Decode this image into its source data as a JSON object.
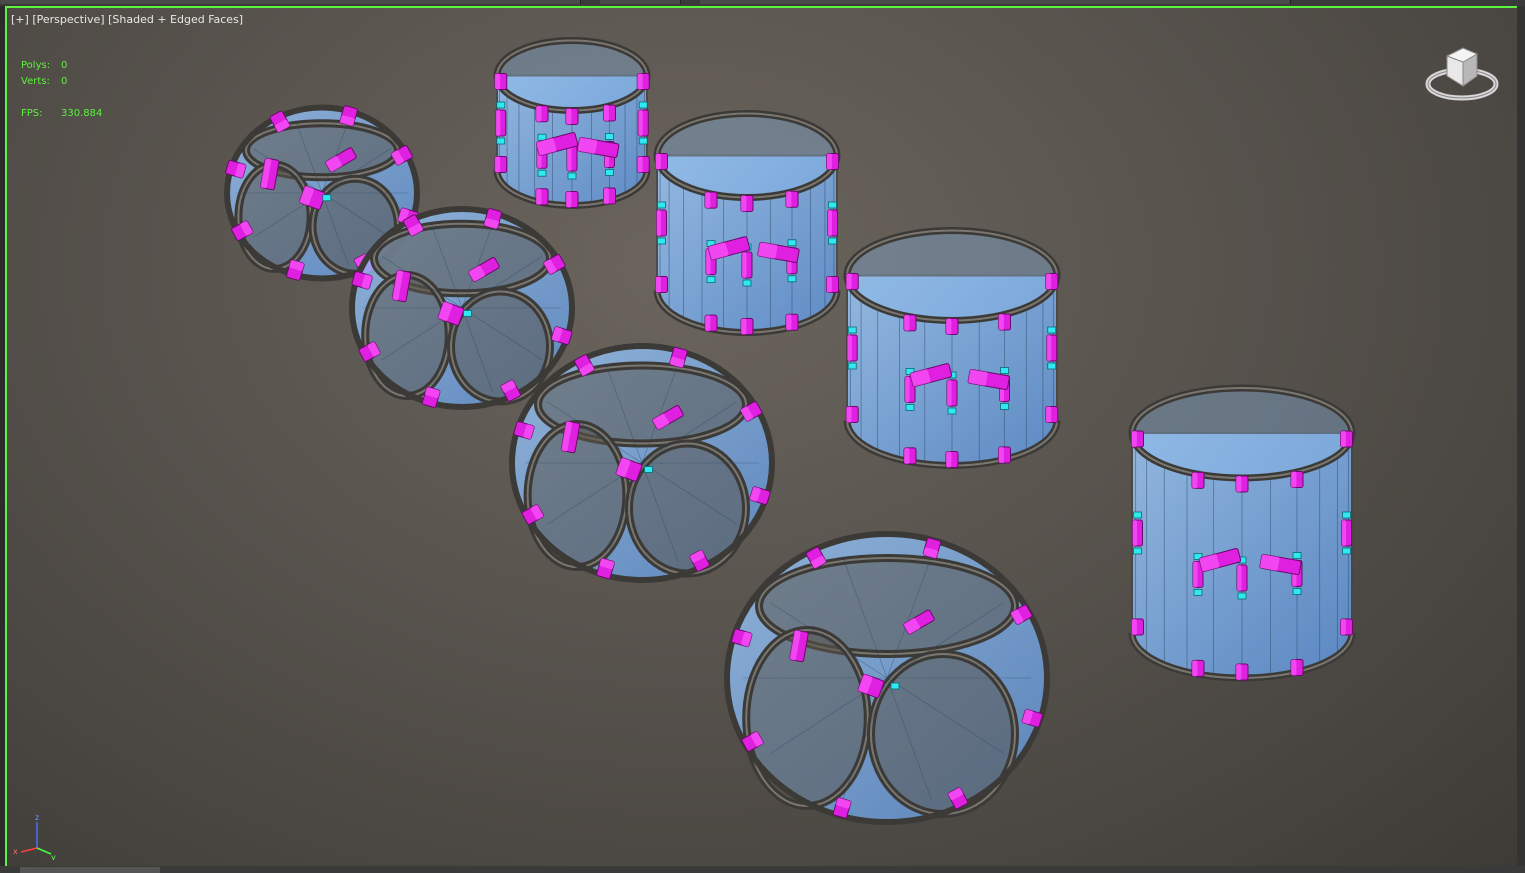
{
  "viewport": {
    "label_plus": "[+]",
    "label_view": "[Perspective]",
    "label_shading": "[Shaded + Edged Faces]",
    "border_color": "#5cf23f"
  },
  "stats": {
    "polys_label": "Polys:",
    "polys_value": "0",
    "verts_label": "Verts:",
    "verts_value": "0",
    "fps_label": "FPS:",
    "fps_value": "330.884"
  },
  "axis": {
    "x": "x",
    "y": "y",
    "z": "z"
  },
  "colors": {
    "frame": "#4a4743",
    "glass": "#7fb4f0",
    "connector": "#e020e0",
    "joint": "#30e8f0"
  }
}
